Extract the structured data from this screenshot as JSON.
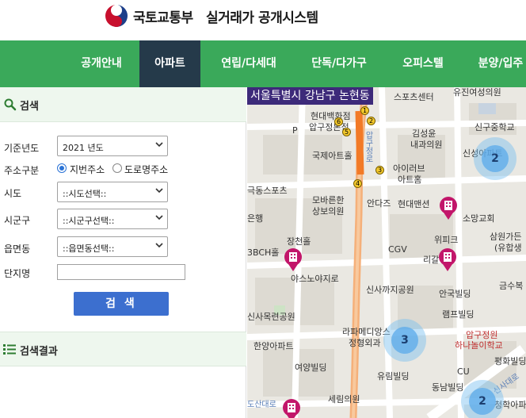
{
  "header": {
    "ministry": "국토교통부",
    "system_name": "실거래가 공개시스템"
  },
  "nav": {
    "items": [
      "공개안내",
      "아파트",
      "연립/다세대",
      "단독/다가구",
      "오피스텔",
      "분양/입주"
    ],
    "active": "아파트"
  },
  "search": {
    "title": "검색",
    "fields": {
      "year": {
        "label": "기준년도",
        "value": "2021 년도"
      },
      "address_type": {
        "label": "주소구분",
        "options": [
          "지번주소",
          "도로명주소"
        ],
        "selected": "지번주소"
      },
      "sido": {
        "label": "시도",
        "value": "::시도선택::"
      },
      "sigungu": {
        "label": "시군구",
        "value": "::시군구선택::"
      },
      "eupmyeondong": {
        "label": "읍면동",
        "value": "::읍면동선택::"
      },
      "complex": {
        "label": "단지명",
        "value": ""
      }
    },
    "button": "검 색"
  },
  "results": {
    "title": "검색결과"
  },
  "map": {
    "location": "서울특별시 강남구 논현동",
    "clusters": [
      "2",
      "3",
      "2"
    ],
    "pois": [
      "스포츠센터",
      "유진여성의원",
      "현대백화점",
      "압구정본점",
      "P",
      "김성윤",
      "내과의원",
      "신구중학교",
      "신성아파트",
      "국제아트홀",
      "압구정로",
      "아이러브",
      "아트홈",
      "극동스포츠",
      "모바른한",
      "상보의원",
      "안다즈",
      "현대맨션",
      "소망교회",
      "은행",
      "장천홀",
      "위피크",
      "삼원가든",
      "(유합생",
      "3BCH홀",
      "CGV",
      "리갈",
      "야스노야지로",
      "신사까지공원",
      "금수복",
      "안국빌딩",
      "신사목련공원",
      "램프빌딩",
      "라파메디앙스",
      "압구정원",
      "정형외과",
      "하나놀이학교",
      "한양아파트",
      "평화빌딩",
      "여양빌딩",
      "유림빌딩",
      "CU",
      "동남빌딩",
      "세림의원",
      "신사대로",
      "청학아파트",
      "도산대로",
      "5",
      "6",
      "1",
      "2",
      "3",
      "4"
    ]
  }
}
